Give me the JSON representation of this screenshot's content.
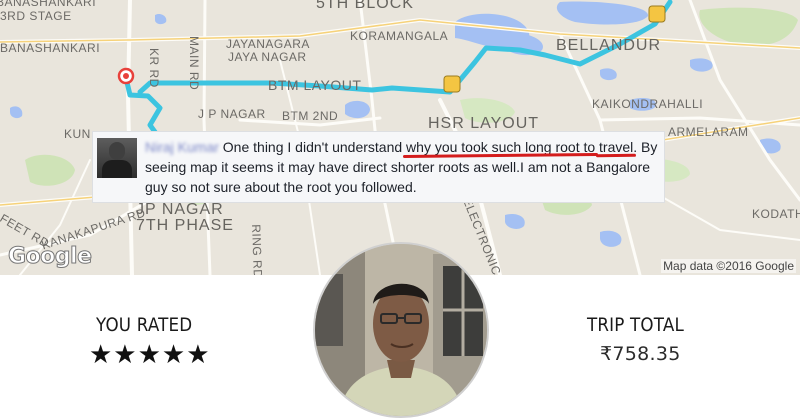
{
  "map": {
    "areas": [
      "BANASHANKARI",
      "3RD STAGE",
      "BANASHANKARI",
      "5TH BLOCK",
      "KORAMANGALA",
      "BELLANDUR",
      "KR Rd",
      "Main Rd",
      "JAYANAGARA",
      "JAYA NAGAR",
      "BTM LAYOUT",
      "J P NAGAR",
      "BTM 2ND",
      "HSR LAYOUT",
      "KAIKONDRAHALLI",
      "KUN",
      "ARMELARAM",
      "JP NAGAR",
      "7TH PHASE",
      "KODATH",
      "Feet Rd",
      "Kanakapura Rd",
      "Ring Rd",
      "Electronic City"
    ],
    "logo_text": "Google",
    "attribution": "Map data ©2016 Google",
    "route_color": "#3cc4e0",
    "pin_color": "#e8413b"
  },
  "comment": {
    "author": "Niraj Kumar",
    "text_before": " One thing I didn't understand ",
    "highlight_1": "why you took such long root to",
    "newline_word": "travel",
    "text_after": ". By seeing map it seems it may have direct shorter roots as well.I am not a Bangalore guy so not sure about the root you followed.",
    "underline_color": "#d41c1c"
  },
  "receipt": {
    "rating_label": "YOU RATED",
    "rating_stars": "★★★★★",
    "rating_value": 5,
    "total_label": "TRIP TOTAL",
    "total_amount": "₹758.35"
  },
  "driver": {
    "photo_icon": "driver-portrait"
  }
}
